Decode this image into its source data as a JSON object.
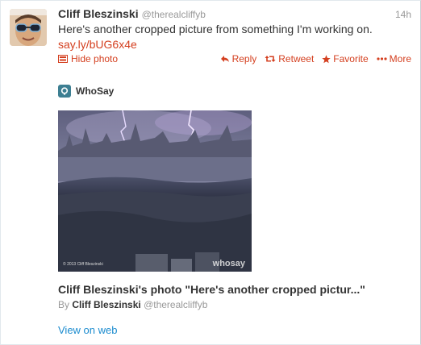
{
  "tweet": {
    "fullname": "Cliff Bleszinski",
    "username": "@therealcliffyb",
    "time": "14h",
    "text": "Here's another cropped picture from something I'm working on.",
    "link": "say.ly/bUG6x4e",
    "actions": {
      "hide_photo": "Hide photo",
      "reply": "Reply",
      "retweet": "Retweet",
      "favorite": "Favorite",
      "more": "More"
    }
  },
  "card": {
    "source": "WhoSay",
    "photo_copyright": "© 2013 Cliff Bleszinski",
    "photo_watermark": "whosay",
    "title": "Cliff Bleszinski's photo \"Here's another cropped pictur...\"",
    "byline_prefix": "By",
    "byline_name": "Cliff Bleszinski",
    "byline_handle": "@therealcliffyb",
    "view_on_web": "View on web"
  },
  "colors": {
    "accent": "#d43f1f",
    "link_blue": "#1c8ccf",
    "muted": "#999999",
    "whosay_brand": "#3d7f92"
  }
}
